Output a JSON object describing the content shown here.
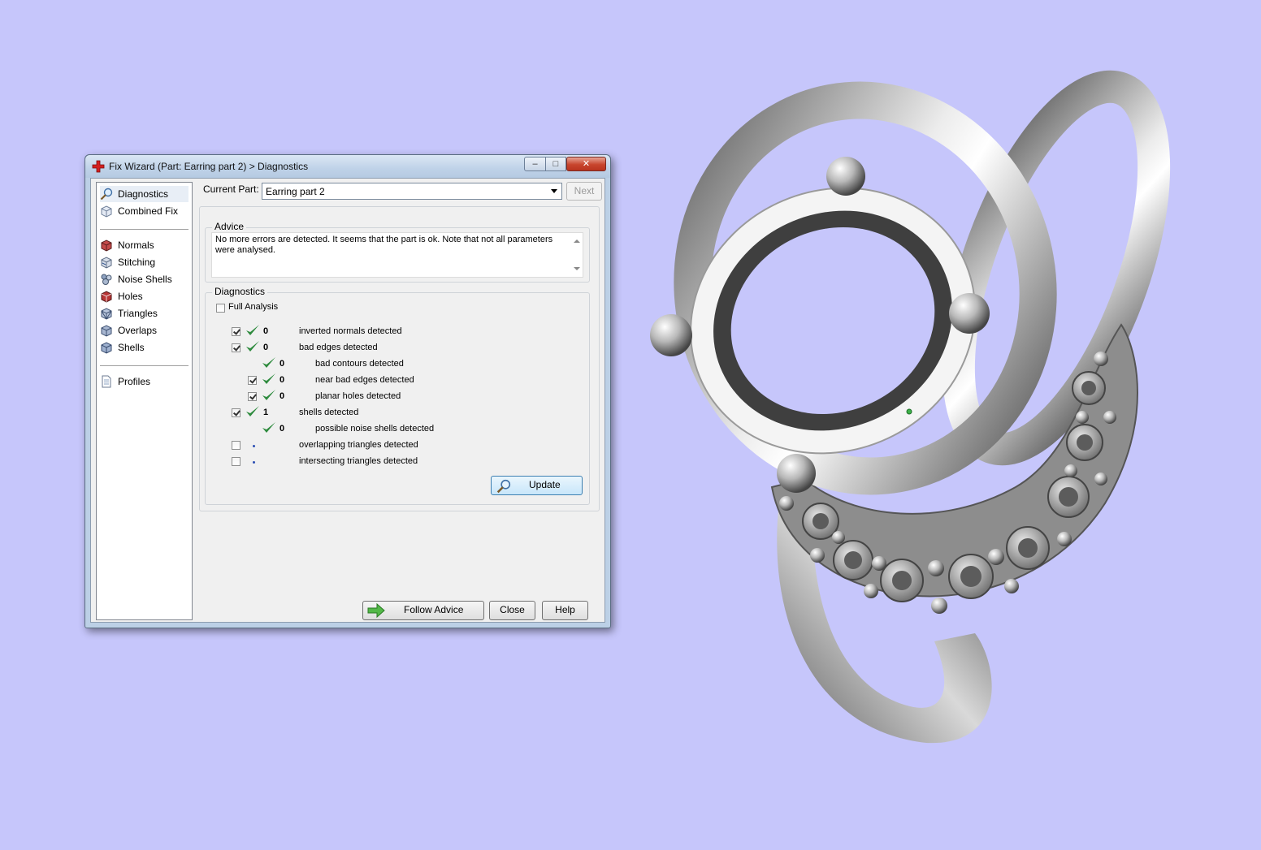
{
  "window": {
    "title": "Fix Wizard (Part: Earring part 2) > Diagnostics",
    "controls": {
      "minimize": "–",
      "maximize": "□",
      "close": "✕"
    }
  },
  "sidebar": {
    "items": [
      {
        "label": "Diagnostics",
        "icon": "magnifier-icon",
        "selected": true
      },
      {
        "label": "Combined Fix",
        "icon": "cube-icon"
      },
      {
        "label": "Normals",
        "icon": "cube-red-icon"
      },
      {
        "label": "Stitching",
        "icon": "cube-stitch-icon"
      },
      {
        "label": "Noise Shells",
        "icon": "noise-shells-icon"
      },
      {
        "label": "Holes",
        "icon": "cube-holes-icon"
      },
      {
        "label": "Triangles",
        "icon": "cube-triangles-icon"
      },
      {
        "label": "Overlaps",
        "icon": "cube-overlaps-icon"
      },
      {
        "label": "Shells",
        "icon": "cube-shells-icon"
      },
      {
        "label": "Profiles",
        "icon": "document-icon"
      }
    ]
  },
  "current_part": {
    "label": "Current Part:",
    "value": "Earring part 2",
    "next_button": "Next"
  },
  "advice": {
    "title": "Advice",
    "text": "No more errors are detected. It seems that the part is ok. Note that not all parameters were analysed."
  },
  "diagnostics": {
    "title": "Diagnostics",
    "full_analysis": "Full Analysis",
    "rows": [
      {
        "checked": true,
        "status": "ok",
        "count": "0",
        "label": "inverted normals detected",
        "indent": 0,
        "has_checkbox": true
      },
      {
        "checked": true,
        "status": "ok",
        "count": "0",
        "label": "bad edges detected",
        "indent": 0,
        "has_checkbox": true
      },
      {
        "checked": false,
        "status": "ok",
        "count": "0",
        "label": "bad contours detected",
        "indent": 1,
        "has_checkbox": false
      },
      {
        "checked": true,
        "status": "ok",
        "count": "0",
        "label": "near bad edges detected",
        "indent": 1,
        "has_checkbox": true
      },
      {
        "checked": true,
        "status": "ok",
        "count": "0",
        "label": "planar holes detected",
        "indent": 1,
        "has_checkbox": true
      },
      {
        "checked": true,
        "status": "ok",
        "count": "1",
        "label": "shells detected",
        "indent": 0,
        "has_checkbox": true
      },
      {
        "checked": false,
        "status": "ok",
        "count": "0",
        "label": "possible noise shells detected",
        "indent": 1,
        "has_checkbox": false
      },
      {
        "checked": false,
        "status": "pending",
        "count": "",
        "label": "overlapping triangles detected",
        "indent": 0,
        "has_checkbox": true
      },
      {
        "checked": false,
        "status": "pending",
        "count": "",
        "label": "intersecting triangles detected",
        "indent": 0,
        "has_checkbox": true
      }
    ],
    "update_button": "Update"
  },
  "footer": {
    "follow_advice": "Follow Advice",
    "close": "Close",
    "help": "Help"
  },
  "colors": {
    "background": "#c6c6fb",
    "check_green": "#2e8b3e",
    "close_red": "#c8452d"
  }
}
